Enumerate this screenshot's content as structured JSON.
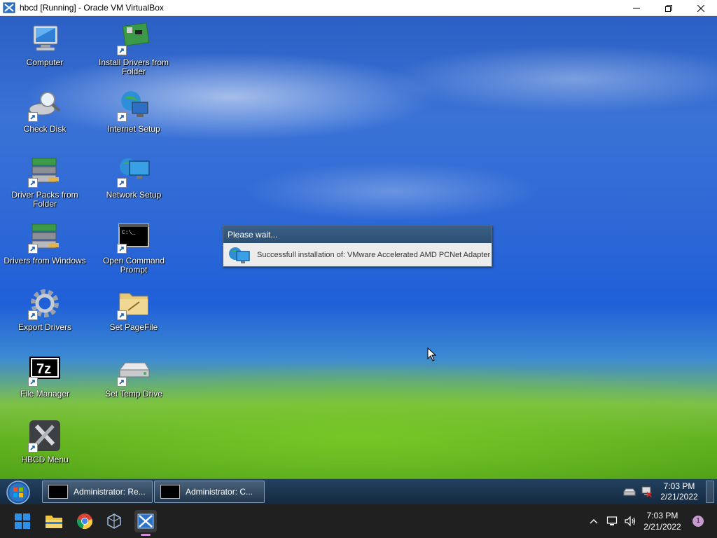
{
  "window": {
    "title": "hbcd [Running] - Oracle VM VirtualBox",
    "controls": [
      "minimize",
      "restore",
      "close"
    ]
  },
  "desktop": {
    "icons": [
      {
        "label": "Computer",
        "icon": "computer-icon",
        "shortcut": false
      },
      {
        "label": "Install Drivers from Folder",
        "icon": "install-drivers-icon",
        "shortcut": true
      },
      {
        "label": "Check Disk",
        "icon": "check-disk-icon",
        "shortcut": true
      },
      {
        "label": "Internet Setup",
        "icon": "internet-setup-icon",
        "shortcut": true
      },
      {
        "label": "Driver Packs from Folder",
        "icon": "driver-packs-icon",
        "shortcut": true
      },
      {
        "label": "Network Setup",
        "icon": "network-setup-icon",
        "shortcut": true
      },
      {
        "label": "Drivers from Windows",
        "icon": "drivers-windows-icon",
        "shortcut": true
      },
      {
        "label": "Open Command Prompt",
        "icon": "command-prompt-icon",
        "shortcut": true
      },
      {
        "label": "Export Drivers",
        "icon": "gear-icon",
        "shortcut": true
      },
      {
        "label": "Set PageFile",
        "icon": "folder-icon",
        "shortcut": true
      },
      {
        "label": "File Manager",
        "icon": "7zip-icon",
        "shortcut": true
      },
      {
        "label": "Set Temp Drive",
        "icon": "drive-icon",
        "shortcut": true
      },
      {
        "label": "HBCD Menu",
        "icon": "tools-icon",
        "shortcut": true
      }
    ]
  },
  "dialog": {
    "title": "Please wait...",
    "message": "Successfull installation of: VMware Accelerated AMD PCNet Adapter",
    "icon": "network-adapter-icon"
  },
  "guest_taskbar": {
    "start": "start-orb-icon",
    "buttons": [
      {
        "label": "Administrator: Re...",
        "icon": "command-prompt-icon"
      },
      {
        "label": "Administrator: C...",
        "icon": "command-prompt-icon"
      }
    ],
    "tray": {
      "time": "7:03 PM",
      "date": "2/21/2022",
      "icons": [
        "drive-icon",
        "network-disconnected-icon"
      ]
    }
  },
  "host_taskbar": {
    "apps": [
      "windows-start-icon",
      "file-explorer-icon",
      "chrome-icon",
      "virtualbox-icon",
      "virtualbox-vm-icon"
    ],
    "time": "7:03 PM",
    "date": "2/21/2022",
    "notification_count": "1",
    "tray_icons": [
      "chevron-up-icon",
      "network-icon",
      "volume-icon"
    ]
  },
  "colors": {
    "accent": "#d58ed8",
    "dialog_title": "#2d4f73",
    "taskbar": "#202020"
  }
}
